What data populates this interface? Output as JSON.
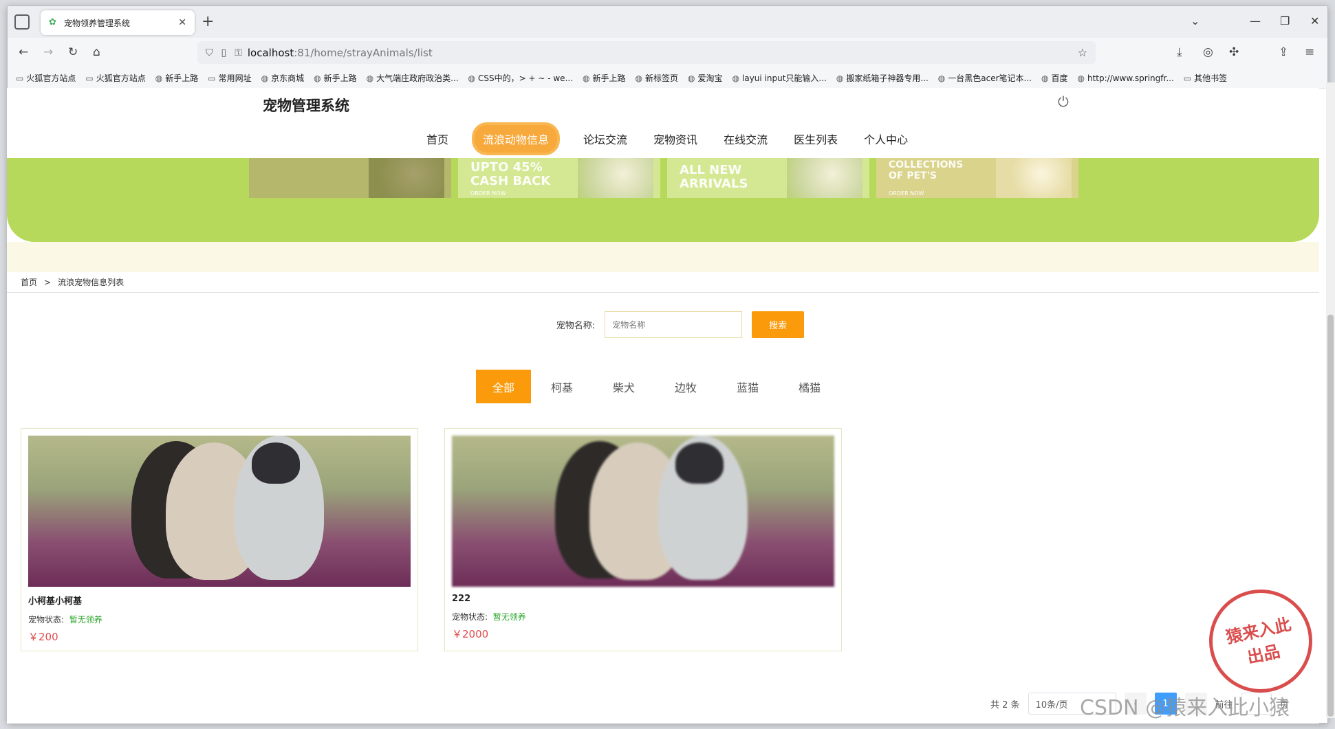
{
  "browser": {
    "tab_title": "宠物领养管理系统",
    "url_host": "localhost",
    "url_rest": ":81/home/strayAnimals/list",
    "bookmarks": [
      "火狐官方站点",
      "火狐官方站点",
      "新手上路",
      "常用网址",
      "京东商城",
      "新手上路",
      "大气端庄政府政治类...",
      "CSS中的，> + ~ - we...",
      "新手上路",
      "新标签页",
      "爱淘宝",
      "layui input只能输入...",
      "搬家纸箱子神器专用...",
      "一台黑色acer笔记本...",
      "百度",
      "http://www.springfr...",
      "其他书签"
    ]
  },
  "site": {
    "brand": "宠物管理系统",
    "menu": [
      "首页",
      "流浪动物信息",
      "论坛交流",
      "宠物资讯",
      "在线交流",
      "医生列表",
      "个人中心"
    ],
    "active_menu_index": 1
  },
  "banner": {
    "cards": [
      {
        "line1": "",
        "line2": "",
        "sub": ""
      },
      {
        "line1": "UPTO 45%",
        "line2": "CASH BACK",
        "sub": "ORDER NOW"
      },
      {
        "line1": "ALL NEW",
        "line2": "ARRIVALS",
        "sub": ""
      },
      {
        "line1": "COLLECTIONS",
        "line2": "OF PET'S",
        "sub": "ORDER NOW"
      }
    ]
  },
  "breadcrumb": {
    "home": "首页",
    "sep": ">",
    "current": "流浪宠物信息列表"
  },
  "search": {
    "label": "宠物名称:",
    "placeholder": "宠物名称",
    "button": "搜索"
  },
  "filters": {
    "items": [
      "全部",
      "柯基",
      "柴犬",
      "边牧",
      "蓝猫",
      "橘猫"
    ],
    "active_index": 0
  },
  "pets": [
    {
      "name": "小柯基小柯基",
      "status_label": "宠物状态:",
      "status": "暂无领养",
      "price": "￥200"
    },
    {
      "name": "222",
      "status_label": "宠物状态:",
      "status": "暂无领养",
      "price": "￥2000"
    }
  ],
  "pager": {
    "total": "共 2 条",
    "page_size": "10条/页",
    "current": "1",
    "goto": "前往",
    "page_suffix": "页"
  },
  "overlay": {
    "stamp_line1": "猿来入此",
    "stamp_line2": "出品",
    "watermark": "CSDN @猿来入此小猿"
  }
}
